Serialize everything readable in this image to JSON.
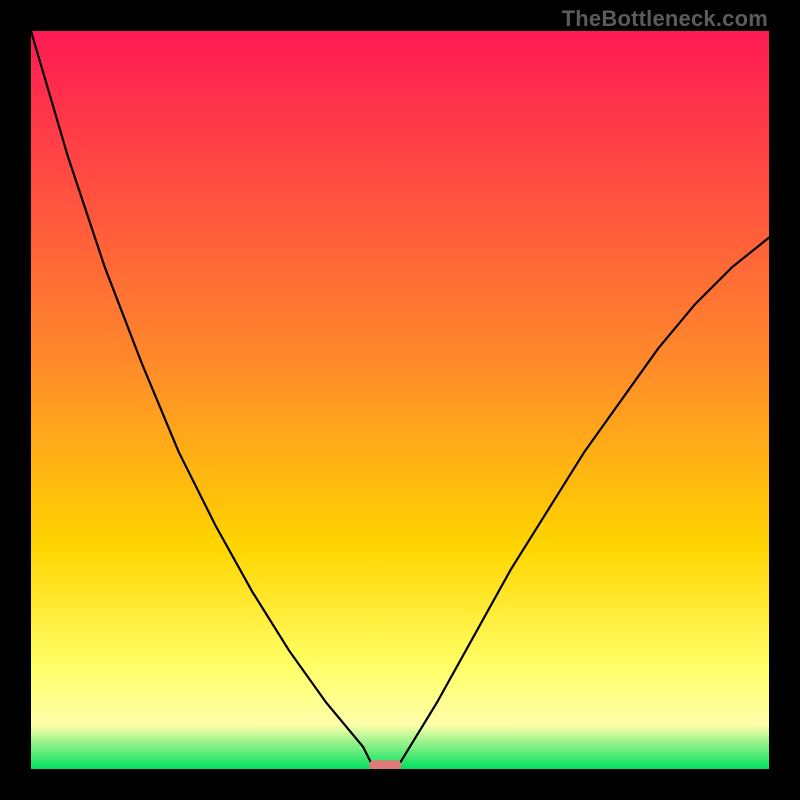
{
  "watermark": {
    "text": "TheBottleneck.com"
  },
  "chart_data": {
    "type": "line",
    "title": "",
    "xlabel": "",
    "ylabel": "",
    "xlim": [
      0,
      100
    ],
    "ylim": [
      0,
      100
    ],
    "grid": false,
    "background_gradient": {
      "stops": [
        {
          "offset": 0,
          "color": "#ff1a54"
        },
        {
          "offset": 45,
          "color": "#ff8a2a"
        },
        {
          "offset": 70,
          "color": "#ffd500"
        },
        {
          "offset": 86,
          "color": "#ffff66"
        },
        {
          "offset": 94,
          "color": "#ffffaa"
        },
        {
          "offset": 100,
          "color": "#00e060"
        }
      ]
    },
    "series": [
      {
        "name": "left-branch",
        "x": [
          0,
          5,
          10,
          15,
          20,
          25,
          30,
          35,
          40,
          45,
          46.5
        ],
        "values": [
          100,
          83,
          68,
          55,
          43,
          33,
          24,
          16,
          9,
          3,
          0
        ]
      },
      {
        "name": "right-branch",
        "x": [
          49.5,
          55,
          60,
          65,
          70,
          75,
          80,
          85,
          90,
          95,
          100
        ],
        "values": [
          0,
          9,
          18,
          27,
          35,
          43,
          50,
          57,
          63,
          68,
          72
        ]
      }
    ],
    "markers": [
      {
        "name": "minimum-marker",
        "x_center": 48,
        "x_halfwidth": 2.2,
        "y": 0.5,
        "color": "#e07a7a"
      }
    ]
  }
}
